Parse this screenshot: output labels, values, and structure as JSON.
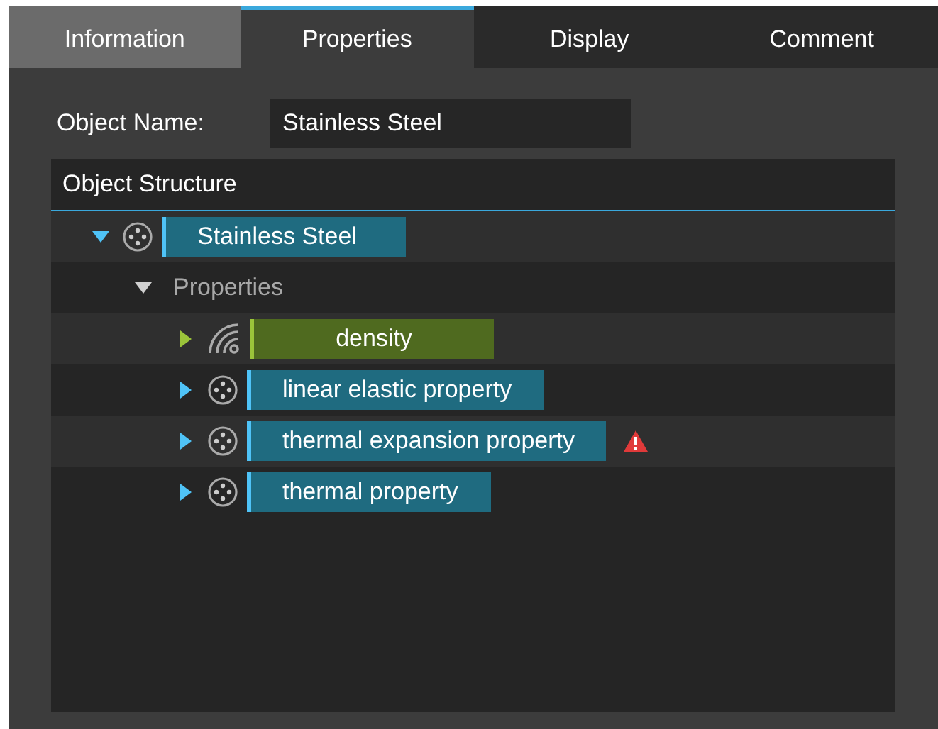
{
  "tabs": [
    {
      "label": "Information",
      "selected": false
    },
    {
      "label": "Properties",
      "selected": true
    },
    {
      "label": "Display",
      "selected": false
    },
    {
      "label": "Comment",
      "selected": false
    }
  ],
  "object_name": {
    "label": "Object Name:",
    "value": "Stainless Steel"
  },
  "structure": {
    "title": "Object Structure",
    "tree": [
      {
        "label": "Stainless Steel",
        "kind": "object",
        "expanded": true,
        "children": [
          {
            "label": "Properties",
            "kind": "group",
            "expanded": true,
            "children": [
              {
                "label": "density",
                "kind": "field",
                "expanded": false,
                "warning": false
              },
              {
                "label": "linear elastic property",
                "kind": "object",
                "expanded": false,
                "warning": false
              },
              {
                "label": "thermal expansion property",
                "kind": "object",
                "expanded": false,
                "warning": true
              },
              {
                "label": "thermal property",
                "kind": "object",
                "expanded": false,
                "warning": false
              }
            ]
          }
        ]
      }
    ]
  }
}
